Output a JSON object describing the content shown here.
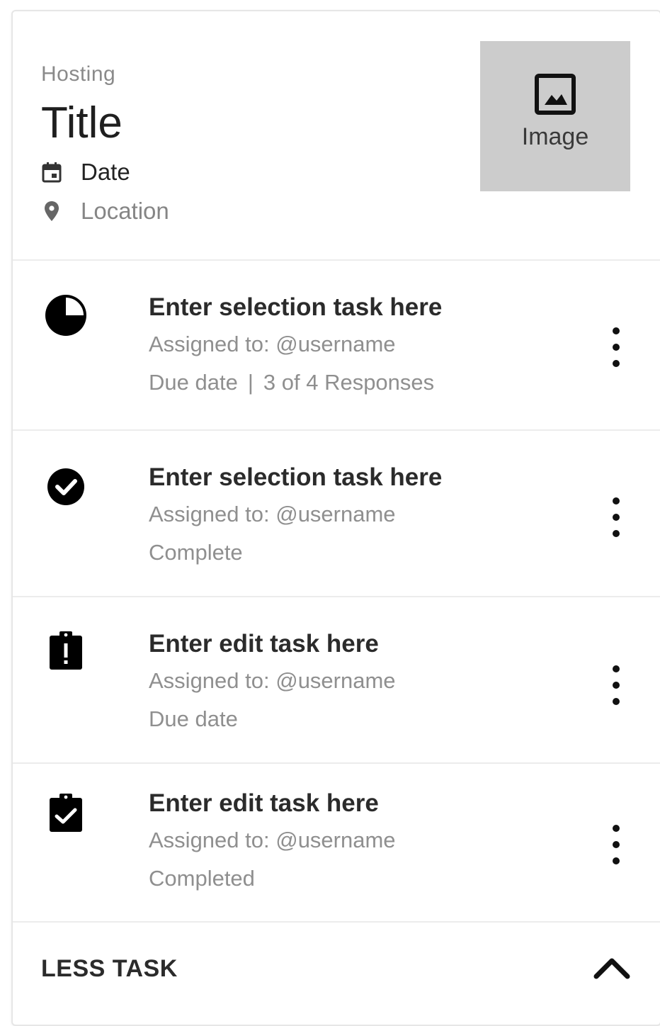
{
  "header": {
    "overline": "Hosting",
    "title": "Title",
    "date_label": "Date",
    "location_label": "Location",
    "image_label": "Image",
    "icons": {
      "date": "calendar-icon",
      "location": "location-pin-icon",
      "image": "image-icon"
    }
  },
  "tasks": [
    {
      "title": "Enter selection task here",
      "assigned": "Assigned to: @username",
      "status": "Due date",
      "responses": "3 of 4 Responses",
      "separator": "|",
      "icon": "pie-progress-icon"
    },
    {
      "title": "Enter selection task here",
      "assigned": "Assigned to: @username",
      "status": "Complete",
      "icon": "check-circle-icon"
    },
    {
      "title": "Enter edit task here",
      "assigned": "Assigned to: @username",
      "status": "Due date",
      "icon": "clipboard-alert-icon"
    },
    {
      "title": "Enter edit task here",
      "assigned": "Assigned to: @username",
      "status": "Completed",
      "icon": "clipboard-check-icon"
    }
  ],
  "footer": {
    "toggle_label": "LESS TASK",
    "icon": "chevron-up-icon"
  }
}
